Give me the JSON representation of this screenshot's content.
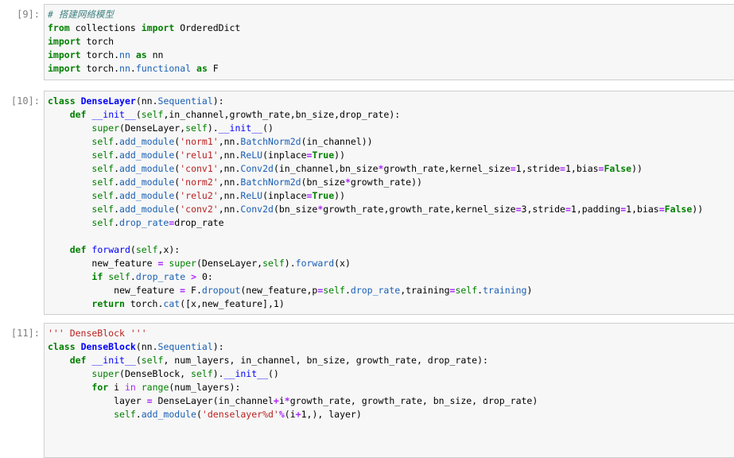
{
  "cells": [
    {
      "prompt": "[9]:",
      "lines": [
        [
          [
            "cm",
            "# 搭建网络模型"
          ]
        ],
        [
          [
            "kw",
            "from"
          ],
          [
            "",
            " collections "
          ],
          [
            "kw",
            "import"
          ],
          [
            "",
            " OrderedDict"
          ]
        ],
        [
          [
            "kw",
            "import"
          ],
          [
            "",
            " torch"
          ]
        ],
        [
          [
            "kw",
            "import"
          ],
          [
            "",
            " torch"
          ],
          [
            "",
            "."
          ],
          [
            "at",
            "nn"
          ],
          [
            "",
            " "
          ],
          [
            "kw",
            "as"
          ],
          [
            "",
            " nn"
          ]
        ],
        [
          [
            "kw",
            "import"
          ],
          [
            "",
            " torch"
          ],
          [
            "",
            "."
          ],
          [
            "at",
            "nn"
          ],
          [
            "",
            "."
          ],
          [
            "at",
            "functional"
          ],
          [
            "",
            " "
          ],
          [
            "kw",
            "as"
          ],
          [
            "",
            " F"
          ]
        ]
      ]
    },
    {
      "prompt": "[10]:",
      "lines": [
        [
          [
            "kw",
            "class"
          ],
          [
            "",
            " "
          ],
          [
            "nc",
            "DenseLayer"
          ],
          [
            "",
            "(nn"
          ],
          [
            "",
            "."
          ],
          [
            "at",
            "Sequential"
          ],
          [
            "",
            "):"
          ]
        ],
        [
          [
            "",
            "    "
          ],
          [
            "kw",
            "def"
          ],
          [
            "",
            " "
          ],
          [
            "mg",
            "__init__"
          ],
          [
            "",
            "("
          ],
          [
            "sf",
            "self"
          ],
          [
            "",
            ",in_channel,growth_rate,bn_size,drop_rate):"
          ]
        ],
        [
          [
            "",
            "        "
          ],
          [
            "bi",
            "super"
          ],
          [
            "",
            "(DenseLayer,"
          ],
          [
            "sf",
            "self"
          ],
          [
            "",
            ")"
          ],
          [
            "",
            "."
          ],
          [
            "mg",
            "__init__"
          ],
          [
            "",
            "()"
          ]
        ],
        [
          [
            "",
            "        "
          ],
          [
            "sf",
            "self"
          ],
          [
            "",
            "."
          ],
          [
            "at",
            "add_module"
          ],
          [
            "",
            "("
          ],
          [
            "st",
            "'norm1'"
          ],
          [
            "",
            ",nn"
          ],
          [
            "",
            "."
          ],
          [
            "at",
            "BatchNorm2d"
          ],
          [
            "",
            "(in_channel))"
          ]
        ],
        [
          [
            "",
            "        "
          ],
          [
            "sf",
            "self"
          ],
          [
            "",
            "."
          ],
          [
            "at",
            "add_module"
          ],
          [
            "",
            "("
          ],
          [
            "st",
            "'relu1'"
          ],
          [
            "",
            ",nn"
          ],
          [
            "",
            "."
          ],
          [
            "at",
            "ReLU"
          ],
          [
            "",
            "(inplace"
          ],
          [
            "op",
            "="
          ],
          [
            "kw",
            "True"
          ],
          [
            "",
            "))"
          ]
        ],
        [
          [
            "",
            "        "
          ],
          [
            "sf",
            "self"
          ],
          [
            "",
            "."
          ],
          [
            "at",
            "add_module"
          ],
          [
            "",
            "("
          ],
          [
            "st",
            "'conv1'"
          ],
          [
            "",
            ",nn"
          ],
          [
            "",
            "."
          ],
          [
            "at",
            "Conv2d"
          ],
          [
            "",
            "(in_channel,bn_size"
          ],
          [
            "op",
            "*"
          ],
          [
            "",
            "growth_rate,kernel_size"
          ],
          [
            "op",
            "="
          ],
          [
            "nu",
            "1"
          ],
          [
            "",
            ",stride"
          ],
          [
            "op",
            "="
          ],
          [
            "nu",
            "1"
          ],
          [
            "",
            ",bias"
          ],
          [
            "op",
            "="
          ],
          [
            "kw",
            "False"
          ],
          [
            "",
            "))"
          ]
        ],
        [
          [
            "",
            "        "
          ],
          [
            "sf",
            "self"
          ],
          [
            "",
            "."
          ],
          [
            "at",
            "add_module"
          ],
          [
            "",
            "("
          ],
          [
            "st",
            "'norm2'"
          ],
          [
            "",
            ",nn"
          ],
          [
            "",
            "."
          ],
          [
            "at",
            "BatchNorm2d"
          ],
          [
            "",
            "(bn_size"
          ],
          [
            "op",
            "*"
          ],
          [
            "",
            "growth_rate))"
          ]
        ],
        [
          [
            "",
            "        "
          ],
          [
            "sf",
            "self"
          ],
          [
            "",
            "."
          ],
          [
            "at",
            "add_module"
          ],
          [
            "",
            "("
          ],
          [
            "st",
            "'relu2'"
          ],
          [
            "",
            ",nn"
          ],
          [
            "",
            "."
          ],
          [
            "at",
            "ReLU"
          ],
          [
            "",
            "(inplace"
          ],
          [
            "op",
            "="
          ],
          [
            "kw",
            "True"
          ],
          [
            "",
            "))"
          ]
        ],
        [
          [
            "",
            "        "
          ],
          [
            "sf",
            "self"
          ],
          [
            "",
            "."
          ],
          [
            "at",
            "add_module"
          ],
          [
            "",
            "("
          ],
          [
            "st",
            "'conv2'"
          ],
          [
            "",
            ",nn"
          ],
          [
            "",
            "."
          ],
          [
            "at",
            "Conv2d"
          ],
          [
            "",
            "(bn_size"
          ],
          [
            "op",
            "*"
          ],
          [
            "",
            "growth_rate,growth_rate,kernel_size"
          ],
          [
            "op",
            "="
          ],
          [
            "nu",
            "3"
          ],
          [
            "",
            ",stride"
          ],
          [
            "op",
            "="
          ],
          [
            "nu",
            "1"
          ],
          [
            "",
            ",padding"
          ],
          [
            "op",
            "="
          ],
          [
            "nu",
            "1"
          ],
          [
            "",
            ",bias"
          ],
          [
            "op",
            "="
          ],
          [
            "kw",
            "False"
          ],
          [
            "",
            "))"
          ]
        ],
        [
          [
            "",
            "        "
          ],
          [
            "sf",
            "self"
          ],
          [
            "",
            "."
          ],
          [
            "at",
            "drop_rate"
          ],
          [
            "op",
            "="
          ],
          [
            "",
            "drop_rate"
          ]
        ],
        [
          [
            "",
            ""
          ]
        ],
        [
          [
            "",
            "    "
          ],
          [
            "kw",
            "def"
          ],
          [
            "",
            " "
          ],
          [
            "nf",
            "forward"
          ],
          [
            "",
            "("
          ],
          [
            "sf",
            "self"
          ],
          [
            "",
            ",x):"
          ]
        ],
        [
          [
            "",
            "        new_feature "
          ],
          [
            "op",
            "="
          ],
          [
            "",
            " "
          ],
          [
            "bi",
            "super"
          ],
          [
            "",
            "(DenseLayer,"
          ],
          [
            "sf",
            "self"
          ],
          [
            "",
            ")"
          ],
          [
            "",
            "."
          ],
          [
            "at",
            "forward"
          ],
          [
            "",
            "(x)"
          ]
        ],
        [
          [
            "",
            "        "
          ],
          [
            "kw",
            "if"
          ],
          [
            "",
            " "
          ],
          [
            "sf",
            "self"
          ],
          [
            "",
            "."
          ],
          [
            "at",
            "drop_rate"
          ],
          [
            "",
            " "
          ],
          [
            "op",
            ">"
          ],
          [
            "",
            " "
          ],
          [
            "nu",
            "0"
          ],
          [
            "",
            ":"
          ]
        ],
        [
          [
            "",
            "            new_feature "
          ],
          [
            "op",
            "="
          ],
          [
            "",
            " F"
          ],
          [
            "",
            "."
          ],
          [
            "at",
            "dropout"
          ],
          [
            "",
            "(new_feature,p"
          ],
          [
            "op",
            "="
          ],
          [
            "sf",
            "self"
          ],
          [
            "",
            "."
          ],
          [
            "at",
            "drop_rate"
          ],
          [
            "",
            ",training"
          ],
          [
            "op",
            "="
          ],
          [
            "sf",
            "self"
          ],
          [
            "",
            "."
          ],
          [
            "at",
            "training"
          ],
          [
            "",
            ")"
          ]
        ],
        [
          [
            "",
            "        "
          ],
          [
            "kw",
            "return"
          ],
          [
            "",
            " torch"
          ],
          [
            "",
            "."
          ],
          [
            "at",
            "cat"
          ],
          [
            "",
            "([x,new_feature],"
          ],
          [
            "nu",
            "1"
          ],
          [
            "",
            ")"
          ]
        ]
      ]
    },
    {
      "prompt": "[11]:",
      "lines": [
        [
          [
            "st",
            "''' DenseBlock '''"
          ]
        ],
        [
          [
            "kw",
            "class"
          ],
          [
            "",
            " "
          ],
          [
            "nc",
            "DenseBlock"
          ],
          [
            "",
            "(nn"
          ],
          [
            "",
            "."
          ],
          [
            "at",
            "Sequential"
          ],
          [
            "",
            "):"
          ]
        ],
        [
          [
            "",
            "    "
          ],
          [
            "kw",
            "def"
          ],
          [
            "",
            " "
          ],
          [
            "mg",
            "__init__"
          ],
          [
            "",
            "("
          ],
          [
            "sf",
            "self"
          ],
          [
            "",
            ", num_layers, in_channel, bn_size, growth_rate, drop_rate):"
          ]
        ],
        [
          [
            "",
            "        "
          ],
          [
            "bi",
            "super"
          ],
          [
            "",
            "(DenseBlock, "
          ],
          [
            "sf",
            "self"
          ],
          [
            "",
            ")"
          ],
          [
            "",
            "."
          ],
          [
            "mg",
            "__init__"
          ],
          [
            "",
            "()"
          ]
        ],
        [
          [
            "",
            "        "
          ],
          [
            "kw",
            "for"
          ],
          [
            "",
            " i "
          ],
          [
            "ow",
            "in"
          ],
          [
            "",
            " "
          ],
          [
            "bi",
            "range"
          ],
          [
            "",
            "(num_layers):"
          ]
        ],
        [
          [
            "",
            "            layer "
          ],
          [
            "op",
            "="
          ],
          [
            "",
            " DenseLayer(in_channel"
          ],
          [
            "op",
            "+"
          ],
          [
            "",
            "i"
          ],
          [
            "op",
            "*"
          ],
          [
            "",
            "growth_rate, growth_rate, bn_size, drop_rate)"
          ]
        ],
        [
          [
            "",
            "            "
          ],
          [
            "sf",
            "self"
          ],
          [
            "",
            "."
          ],
          [
            "at",
            "add_module"
          ],
          [
            "",
            "("
          ],
          [
            "st",
            "'denselayer%d'"
          ],
          [
            "op",
            "%"
          ],
          [
            "",
            "(i"
          ],
          [
            "op",
            "+"
          ],
          [
            "nu",
            "1"
          ],
          [
            "",
            ",), layer)"
          ]
        ]
      ]
    }
  ]
}
